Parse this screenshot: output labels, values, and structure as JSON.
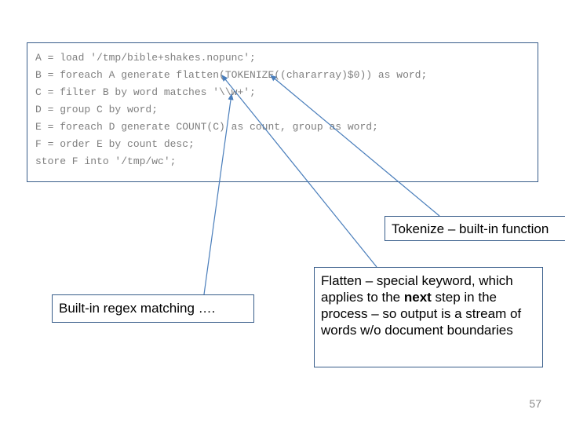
{
  "code": {
    "lineA": "A = load '/tmp/bible+shakes.nopunc';",
    "lineB": "B = foreach A generate flatten(TOKENIZE((chararray)$0)) as word;",
    "lineC": "C = filter B by word matches '\\\\w+';",
    "lineD": "D = group C by word;",
    "lineE": "E = foreach D generate COUNT(C) as count, group as word;",
    "lineF": "F = order E by count desc;",
    "lineStore": "store F into '/tmp/wc';"
  },
  "callouts": {
    "tokenize": "Tokenize – built-in function",
    "regex": "Built-in regex matching ….",
    "flatten_prefix": "Flatten – special keyword, which applies to the ",
    "flatten_bold": "next",
    "flatten_suffix": " step in the process – so output is a stream of words w/o document boundaries"
  },
  "page_number": "57"
}
